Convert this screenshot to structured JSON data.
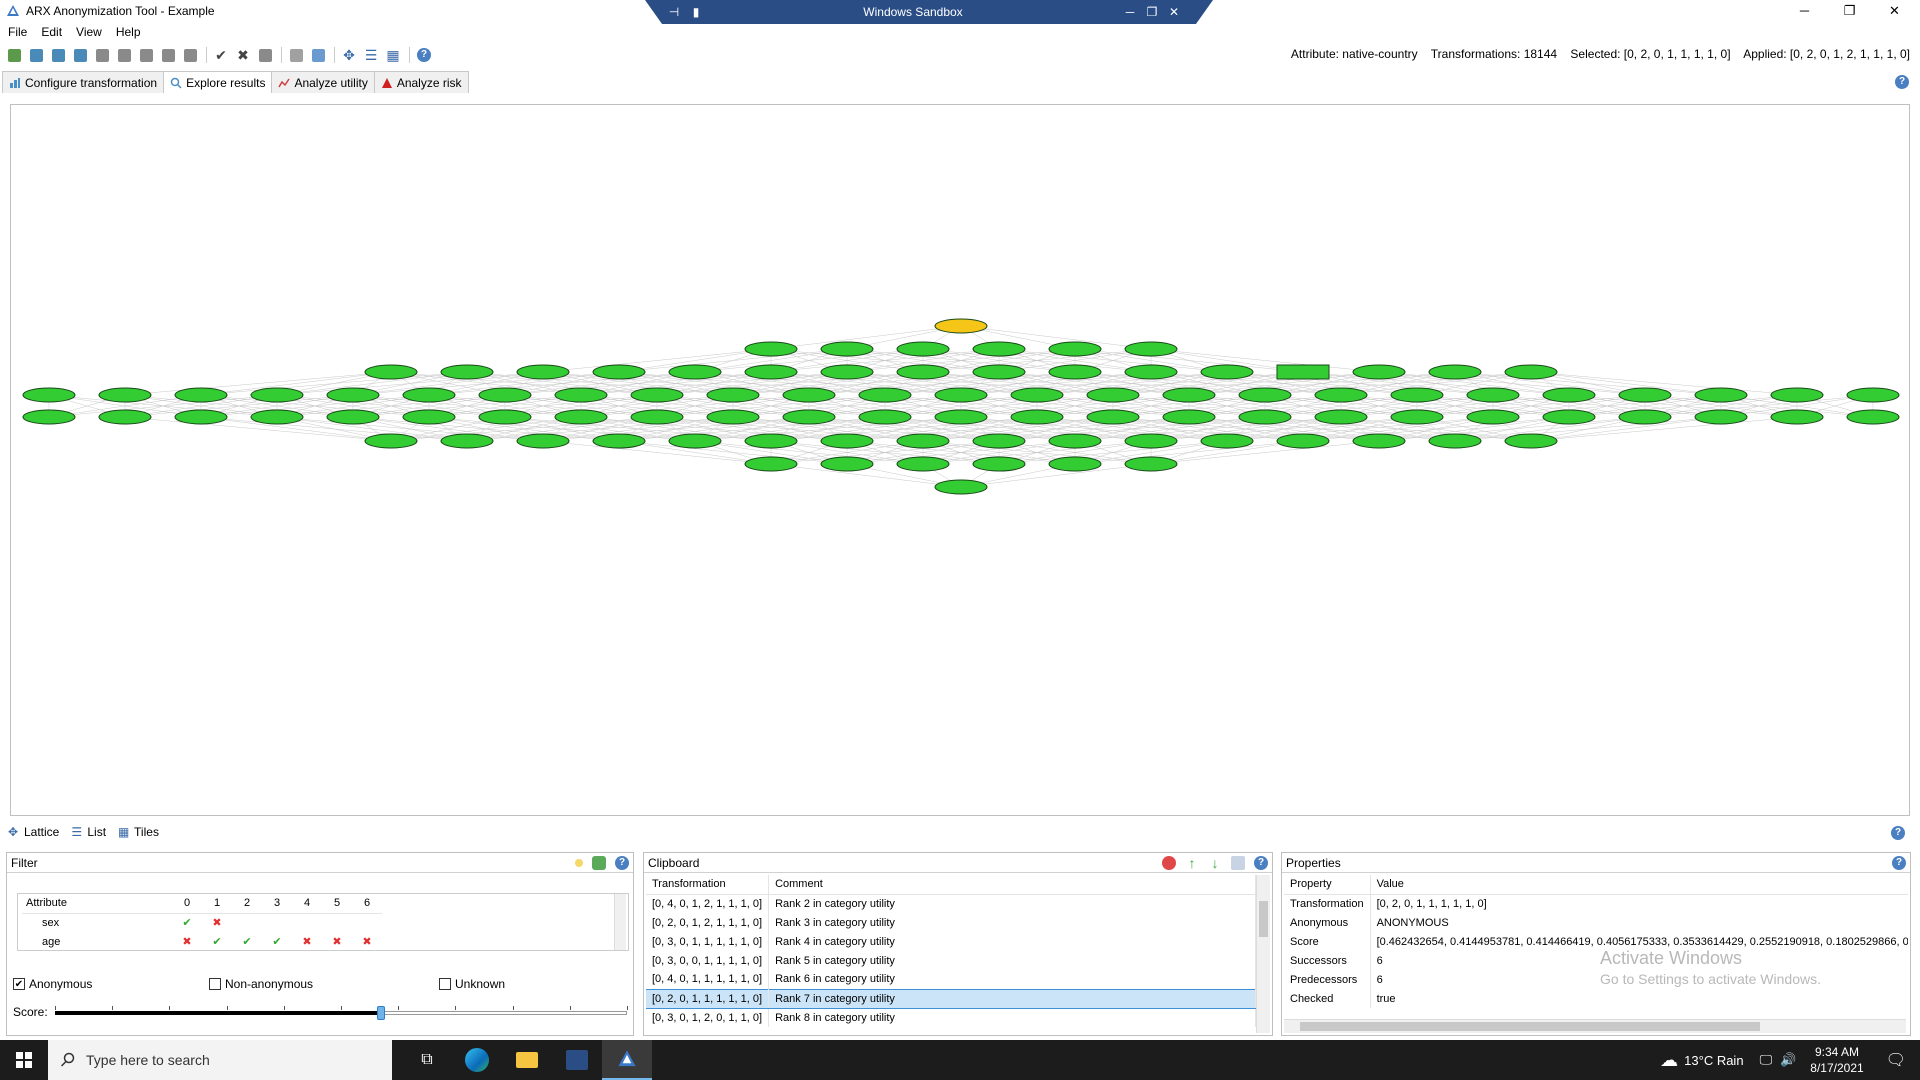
{
  "window": {
    "title": "ARX Anonymization Tool - Example",
    "sandbox_title": "Windows Sandbox",
    "minimize": "─",
    "maximize": "❐",
    "close": "✕"
  },
  "menu": [
    "File",
    "Edit",
    "View",
    "Help"
  ],
  "status": {
    "attribute": "Attribute: native-country",
    "transformations": "Transformations: 18144",
    "selected": "Selected: [0, 2, 0, 1, 1, 1, 1, 0]",
    "applied": "Applied: [0, 2, 0, 1, 2, 1, 1, 1, 0]"
  },
  "tabs": [
    {
      "label": "Configure transformation",
      "color": "#4a90c8"
    },
    {
      "label": "Explore results",
      "color": "#4a90c8"
    },
    {
      "label": "Analyze utility",
      "color": "#d04040"
    },
    {
      "label": "Analyze risk",
      "color": "#d02020"
    }
  ],
  "view_tabs": [
    "Lattice",
    "List",
    "Tiles"
  ],
  "lattice": {
    "node_color": "#33cc33",
    "selected_color": "#f5c518",
    "edge_color": "#c8c8c8"
  },
  "filter": {
    "title": "Filter",
    "attribute_header": "Attribute",
    "levels": [
      "0",
      "1",
      "2",
      "3",
      "4",
      "5",
      "6"
    ],
    "rows": [
      {
        "name": "sex",
        "marks": [
          "check",
          "cross",
          "",
          "",
          "",
          "",
          ""
        ]
      },
      {
        "name": "age",
        "marks": [
          "cross",
          "check",
          "check",
          "check",
          "cross",
          "cross",
          "cross"
        ]
      }
    ],
    "checkboxes": [
      {
        "label": "Anonymous",
        "checked": true
      },
      {
        "label": "Non-anonymous",
        "checked": false
      },
      {
        "label": "Unknown",
        "checked": false
      }
    ],
    "score_label": "Score:",
    "score_value": 0.57
  },
  "clipboard": {
    "title": "Clipboard",
    "headers": [
      "Transformation",
      "Comment"
    ],
    "rows": [
      {
        "t": "[0, 4, 0, 1, 2, 1, 1, 1, 0]",
        "c": "Rank 2 in category utility"
      },
      {
        "t": "[0, 2, 0, 1, 2, 1, 1, 1, 0]",
        "c": "Rank 3 in category utility"
      },
      {
        "t": "[0, 3, 0, 1, 1, 1, 1, 1, 0]",
        "c": "Rank 4 in category utility"
      },
      {
        "t": "[0, 3, 0, 0, 1, 1, 1, 1, 0]",
        "c": "Rank 5 in category utility"
      },
      {
        "t": "[0, 4, 0, 1, 1, 1, 1, 1, 0]",
        "c": "Rank 6 in category utility"
      },
      {
        "t": "[0, 2, 0, 1, 1, 1, 1, 1, 0]",
        "c": "Rank 7 in category utility"
      },
      {
        "t": "[0, 3, 0, 1, 2, 0, 1, 1, 0]",
        "c": "Rank 8 in category utility"
      }
    ],
    "selected_index": 5
  },
  "properties": {
    "title": "Properties",
    "headers": [
      "Property",
      "Value"
    ],
    "rows": [
      {
        "p": "Transformation",
        "v": "[0, 2, 0, 1, 1, 1, 1, 1, 0]"
      },
      {
        "p": "Anonymous",
        "v": "ANONYMOUS"
      },
      {
        "p": "Score",
        "v": "[0.462432654, 0.4144953781, 0.414466419, 0.4056175333, 0.3533614429, 0.2552190918, 0.1802529866, 0."
      },
      {
        "p": "Successors",
        "v": "6"
      },
      {
        "p": "Predecessors",
        "v": "6"
      },
      {
        "p": "Checked",
        "v": "true"
      }
    ]
  },
  "watermark": {
    "line1": "Activate Windows",
    "line2": "Go to Settings to activate Windows."
  },
  "taskbar": {
    "search_placeholder": "Type here to search",
    "weather": "13°C  Rain",
    "time": "9:34 AM",
    "date": "8/17/2021"
  }
}
